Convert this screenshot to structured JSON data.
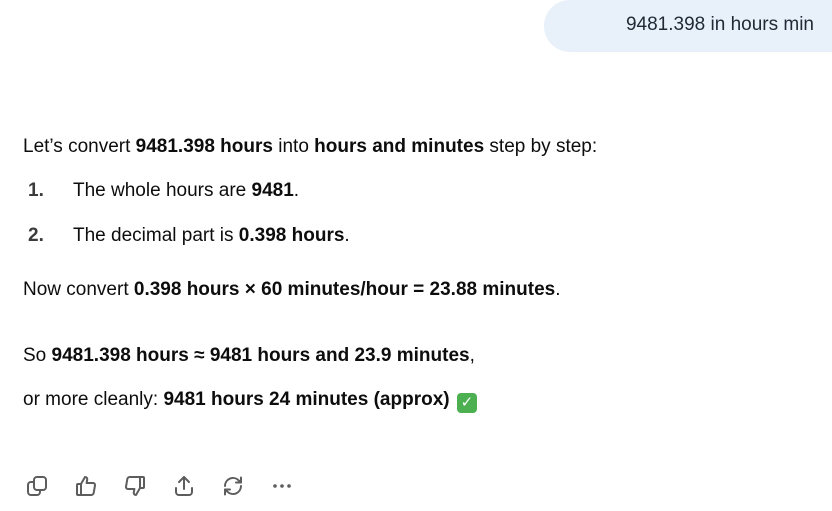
{
  "user_message": "9481.398 in hours min",
  "answer": {
    "intro": {
      "t1": "Let’s convert ",
      "b1": "9481.398 hours",
      "t2": " into ",
      "b2": "hours and minutes",
      "t3": " step by step:"
    },
    "steps": [
      {
        "num": "1.",
        "text": "The whole hours are ",
        "bold": "9481",
        "tail": "."
      },
      {
        "num": "2.",
        "text": "The decimal part is ",
        "bold": "0.398 hours",
        "tail": "."
      }
    ],
    "convert": {
      "t1": "Now convert ",
      "b1": "0.398 hours × 60 minutes/hour = 23.88 minutes",
      "t2": "."
    },
    "so": {
      "t1": "So ",
      "b1": "9481.398 hours ≈ 9481 hours and 23.9 minutes",
      "t2": ","
    },
    "cleanly": {
      "t1": "or more cleanly: ",
      "b1": "9481 hours 24 minutes (approx)",
      "emoji": "✓"
    }
  },
  "actions": [
    {
      "icon": "copy-icon"
    },
    {
      "icon": "thumbs-up-icon"
    },
    {
      "icon": "thumbs-down-icon"
    },
    {
      "icon": "share-icon"
    },
    {
      "icon": "regenerate-icon"
    },
    {
      "icon": "more-icon"
    }
  ],
  "colors": {
    "user_bubble": "#e8f0f9",
    "text": "#0d0d0d",
    "check": "#4cb050",
    "icon": "#5d5d5d"
  }
}
